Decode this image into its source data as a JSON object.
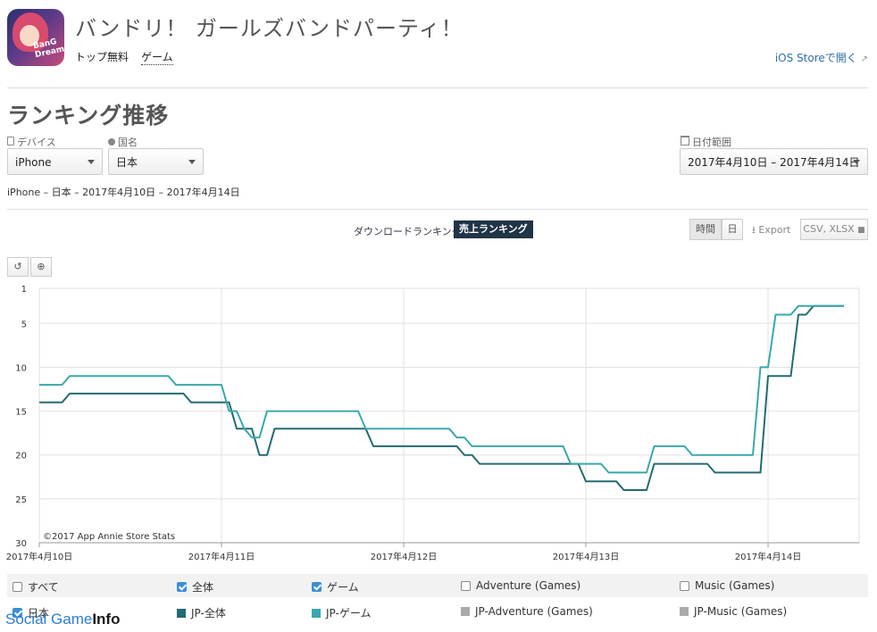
{
  "app": {
    "title": "バンドリ！ ガールズバンドパーティ！",
    "icon_text": "BanG Dream!",
    "categories": [
      "トップ無料",
      "ゲーム"
    ],
    "store_link": "iOS Storeで開く"
  },
  "section": {
    "title": "ランキング推移"
  },
  "filters": {
    "device_label": "デバイス",
    "device_value": "iPhone",
    "country_label": "国名",
    "country_value": "日本",
    "date_label": "日付範囲",
    "date_value": "2017年4月10日 – 2017年4月14日",
    "summary": "iPhone – 日本 – 2017年4月10日 – 2017年4月14日"
  },
  "tabs": {
    "download": "ダウンロードランキング",
    "sales": "売上ランキング"
  },
  "controls": {
    "hourly": "時間",
    "daily": "日",
    "export": "Export",
    "csv": "CSV, XLSX"
  },
  "colors": {
    "overall": "#236b72",
    "game": "#3aa8ab",
    "gray": "#aaaaaa",
    "accent": "#1f3447"
  },
  "chart_data": {
    "type": "line",
    "title": "",
    "copyright": "©2017 App Annie Store Stats",
    "y_inverted": true,
    "ylim": [
      1,
      30
    ],
    "yticks": [
      "1",
      "5",
      "10",
      "15",
      "20",
      "25",
      "30"
    ],
    "xlim": [
      "2017-04-10 00:00",
      "2017-04-14 12:00"
    ],
    "xticks": [
      "2017年4月10日",
      "2017年4月11日",
      "2017年4月12日",
      "2017年4月13日",
      "2017年4月14日"
    ],
    "grid": true,
    "series": [
      {
        "name": "JP-全体",
        "color": "#236b72",
        "points": [
          [
            "2017-04-10 00:00",
            14
          ],
          [
            "2017-04-10 03:00",
            14
          ],
          [
            "2017-04-10 04:00",
            13
          ],
          [
            "2017-04-10 19:00",
            13
          ],
          [
            "2017-04-10 20:00",
            14
          ],
          [
            "2017-04-11 01:00",
            14
          ],
          [
            "2017-04-11 02:00",
            17
          ],
          [
            "2017-04-11 04:00",
            17
          ],
          [
            "2017-04-11 05:00",
            20
          ],
          [
            "2017-04-11 06:00",
            20
          ],
          [
            "2017-04-11 07:00",
            17
          ],
          [
            "2017-04-11 19:00",
            17
          ],
          [
            "2017-04-11 20:00",
            19
          ],
          [
            "2017-04-12 07:00",
            19
          ],
          [
            "2017-04-12 08:00",
            20
          ],
          [
            "2017-04-12 09:00",
            20
          ],
          [
            "2017-04-12 10:00",
            21
          ],
          [
            "2017-04-12 23:00",
            21
          ],
          [
            "2017-04-13 00:00",
            23
          ],
          [
            "2017-04-13 04:00",
            23
          ],
          [
            "2017-04-13 05:00",
            24
          ],
          [
            "2017-04-13 08:00",
            24
          ],
          [
            "2017-04-13 09:00",
            21
          ],
          [
            "2017-04-13 16:00",
            21
          ],
          [
            "2017-04-13 17:00",
            22
          ],
          [
            "2017-04-13 23:00",
            22
          ],
          [
            "2017-04-14 00:00",
            11
          ],
          [
            "2017-04-14 03:00",
            11
          ],
          [
            "2017-04-14 04:00",
            4
          ],
          [
            "2017-04-14 05:00",
            4
          ],
          [
            "2017-04-14 06:00",
            3
          ],
          [
            "2017-04-14 10:00",
            3
          ]
        ]
      },
      {
        "name": "JP-ゲーム",
        "color": "#3aa8ab",
        "points": [
          [
            "2017-04-10 00:00",
            12
          ],
          [
            "2017-04-10 03:00",
            12
          ],
          [
            "2017-04-10 04:00",
            11
          ],
          [
            "2017-04-10 17:00",
            11
          ],
          [
            "2017-04-10 18:00",
            12
          ],
          [
            "2017-04-11 00:00",
            12
          ],
          [
            "2017-04-11 01:00",
            15
          ],
          [
            "2017-04-11 02:00",
            15
          ],
          [
            "2017-04-11 03:00",
            17
          ],
          [
            "2017-04-11 04:00",
            18
          ],
          [
            "2017-04-11 05:00",
            18
          ],
          [
            "2017-04-11 06:00",
            15
          ],
          [
            "2017-04-11 18:00",
            15
          ],
          [
            "2017-04-11 19:00",
            17
          ],
          [
            "2017-04-12 06:00",
            17
          ],
          [
            "2017-04-12 07:00",
            18
          ],
          [
            "2017-04-12 08:00",
            18
          ],
          [
            "2017-04-12 09:00",
            19
          ],
          [
            "2017-04-12 21:00",
            19
          ],
          [
            "2017-04-12 22:00",
            21
          ],
          [
            "2017-04-13 02:00",
            21
          ],
          [
            "2017-04-13 03:00",
            22
          ],
          [
            "2017-04-13 08:00",
            22
          ],
          [
            "2017-04-13 09:00",
            19
          ],
          [
            "2017-04-13 13:00",
            19
          ],
          [
            "2017-04-13 14:00",
            20
          ],
          [
            "2017-04-13 22:00",
            20
          ],
          [
            "2017-04-13 23:00",
            10
          ],
          [
            "2017-04-14 00:00",
            10
          ],
          [
            "2017-04-14 01:00",
            4
          ],
          [
            "2017-04-14 03:00",
            4
          ],
          [
            "2017-04-14 04:00",
            3
          ],
          [
            "2017-04-14 10:00",
            3
          ]
        ]
      }
    ]
  },
  "legend": {
    "row1": [
      "すべて",
      "全体",
      "ゲーム",
      "Adventure (Games)",
      "Music (Games)"
    ],
    "row2": [
      "日本",
      "JP-全体",
      "JP-ゲーム",
      "JP-Adventure (Games)",
      "JP-Music (Games)"
    ]
  },
  "watermark": {
    "part1": "Social Game",
    "part2": "Info"
  }
}
